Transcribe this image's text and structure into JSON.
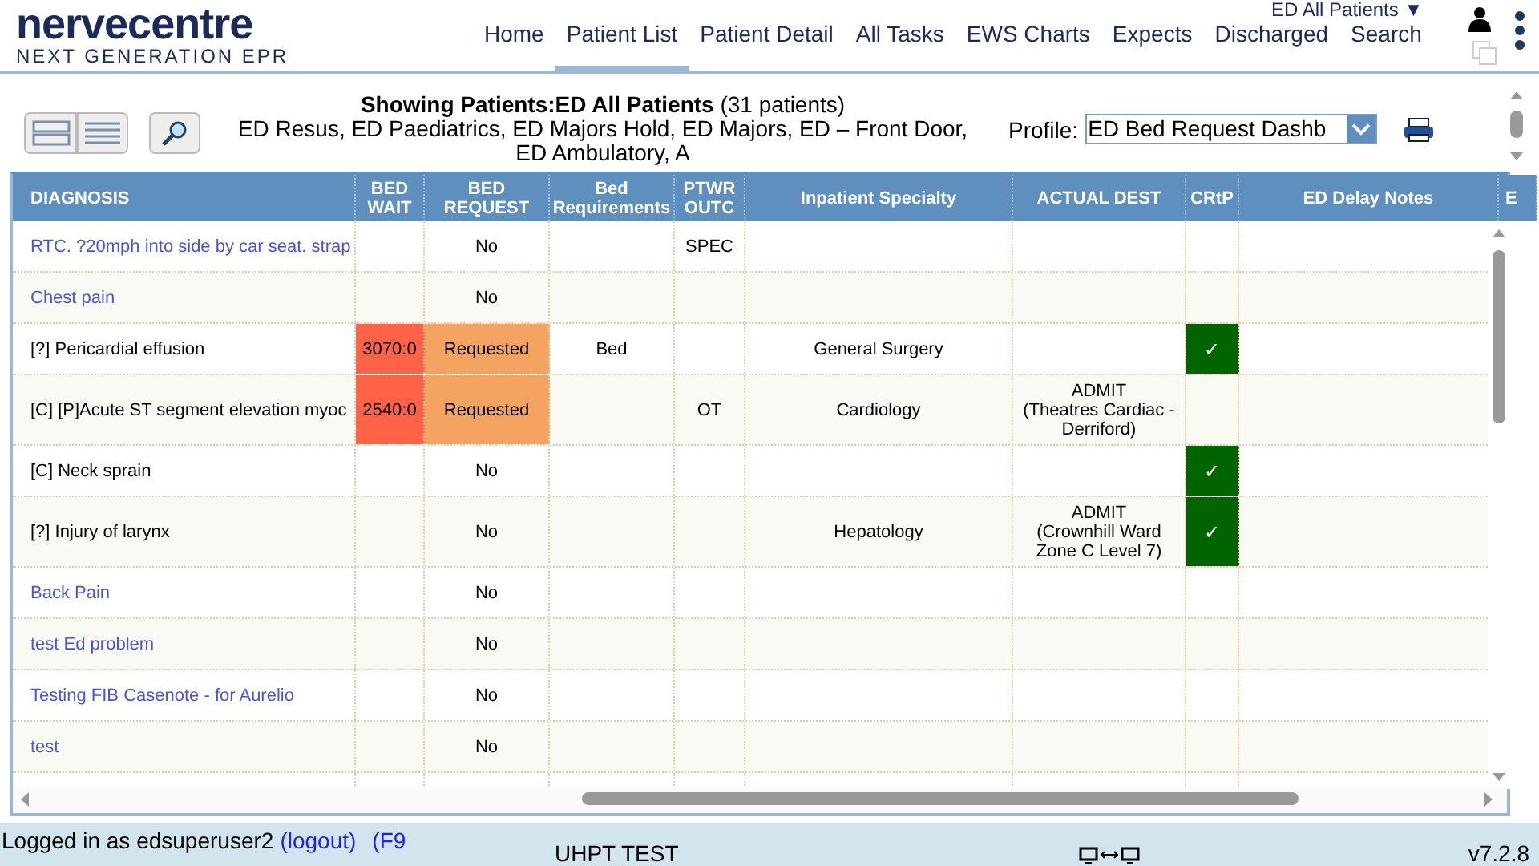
{
  "brand": {
    "name": "nervecentre",
    "tagline": "NEXT GENERATION EPR"
  },
  "nav": [
    {
      "label": "Home",
      "selected": false
    },
    {
      "label": "Patient List",
      "selected": true
    },
    {
      "label": "Patient Detail",
      "selected": false
    },
    {
      "label": "All Tasks",
      "selected": false
    },
    {
      "label": "EWS Charts",
      "selected": false
    },
    {
      "label": "Expects",
      "selected": false
    },
    {
      "label": "Discharged",
      "selected": false
    },
    {
      "label": "Search",
      "selected": false
    }
  ],
  "list_selector": "ED All Patients ▼",
  "toolbar": {
    "title": "Showing Patients:ED All Patients",
    "count": "(31 patients)",
    "locations": "ED Resus, ED Paediatrics, ED Majors Hold, ED Majors, ED – Front Door, ED Ambulatory, A",
    "profile_label": "Profile:",
    "profile_value": "ED Bed Request Dashb"
  },
  "table": {
    "columns": [
      "DIAGNOSIS",
      "BED WAIT",
      "BED REQUEST",
      "Bed Requirements",
      "PTWR OUTC",
      "Inpatient Specialty",
      "ACTUAL DEST",
      "CRtP",
      "ED Delay Notes",
      "E"
    ],
    "rows": [
      {
        "diagnosis": "RTC. ?20mph into side by car seat. strap",
        "link": true,
        "bed_wait": "",
        "bed_request": "No",
        "requested": false,
        "bed_requirements": "",
        "ptwr": "SPEC",
        "specialty": ""
      },
      {
        "diagnosis": "Chest pain",
        "link": true,
        "bed_wait": "",
        "bed_request": "No",
        "requested": false,
        "bed_requirements": "",
        "ptwr": "",
        "specialty": ""
      },
      {
        "diagnosis": "[?] Pericardial effusion",
        "link": false,
        "bed_wait": "3070:0",
        "bed_request": "Requested",
        "requested": true,
        "bed_requirements": "Bed",
        "ptwr": "",
        "specialty": "General Surgery",
        "crtp": "✓"
      },
      {
        "diagnosis": "[C] [P]Acute ST segment elevation myoc",
        "link": false,
        "bed_wait": "2540:0",
        "bed_request": "Requested",
        "requested": true,
        "bed_requirements": "",
        "ptwr": "OT",
        "specialty": "Cardiology",
        "actual_dest": [
          "ADMIT",
          "(Theatres Cardiac - Derriford)"
        ]
      },
      {
        "diagnosis": "[C] Neck sprain",
        "link": false,
        "bed_wait": "",
        "bed_request": "No",
        "requested": false,
        "bed_requirements": "",
        "ptwr": "",
        "specialty": "",
        "crtp": "✓"
      },
      {
        "diagnosis": "[?] Injury of larynx",
        "link": false,
        "bed_wait": "",
        "bed_request": "No",
        "requested": false,
        "bed_requirements": "",
        "ptwr": "",
        "specialty": "Hepatology",
        "actual_dest": [
          "ADMIT",
          "(Crownhill Ward Zone C Level 7)"
        ],
        "crtp": "✓"
      },
      {
        "diagnosis": "Back Pain",
        "link": true,
        "bed_wait": "",
        "bed_request": "No",
        "requested": false,
        "bed_requirements": "",
        "ptwr": "",
        "specialty": ""
      },
      {
        "diagnosis": "test Ed problem",
        "link": true,
        "bed_wait": "",
        "bed_request": "No",
        "requested": false,
        "bed_requirements": "",
        "ptwr": "",
        "specialty": ""
      },
      {
        "diagnosis": "Testing FIB Casenote - for Aurelio",
        "link": true,
        "bed_wait": "",
        "bed_request": "No",
        "requested": false,
        "bed_requirements": "",
        "ptwr": "",
        "specialty": ""
      },
      {
        "diagnosis": "test",
        "link": true,
        "bed_wait": "",
        "bed_request": "No",
        "requested": false,
        "bed_requirements": "",
        "ptwr": "",
        "specialty": ""
      }
    ]
  },
  "status_bar": {
    "user": "Logged in as edsuperuser2",
    "logout": "(logout)",
    "lock": "(F9",
    "environment": "UHPT TEST",
    "version": "v7.2.8"
  }
}
